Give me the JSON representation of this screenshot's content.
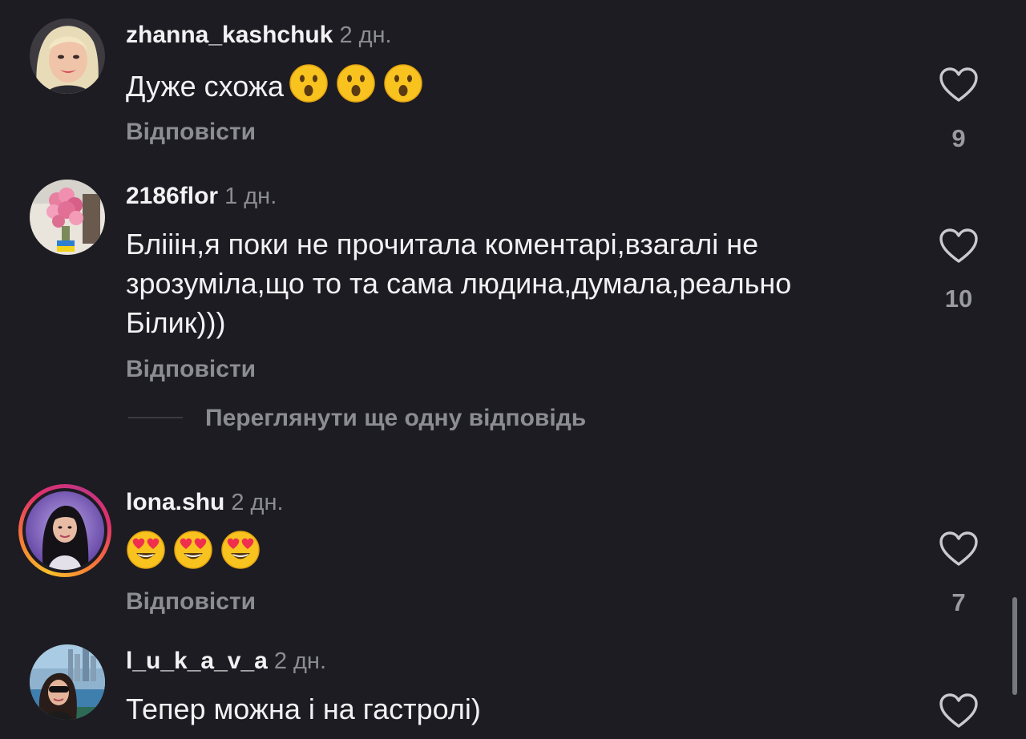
{
  "colors": {
    "background": "#1c1c22",
    "primary_text": "#f2f2f4",
    "secondary_text": "#8c8c93",
    "story_ring": [
      "#f9c02a",
      "#e1306c",
      "#c13584"
    ]
  },
  "comments": [
    {
      "username": "zhanna_kashchuk",
      "time": "2 дн.",
      "text": "Дуже схожа",
      "emoji": [
        "hushed-face-emoji",
        "hushed-face-emoji",
        "hushed-face-emoji"
      ],
      "reply_label": "Відповісти",
      "likes": "9",
      "icon": "heart-icon"
    },
    {
      "username": "2186flor",
      "time": "1 дн.",
      "text": "Бліiін,я поки не прочитала коментарі,взагалі не зрозуміла,що то та сама людина,думала,реально Білик)))",
      "reply_label": "Відповісти",
      "view_replies_label": "Переглянути ще одну відповідь",
      "likes": "10",
      "icon": "heart-icon"
    },
    {
      "username": "lona.shu",
      "time": "2 дн.",
      "text": "",
      "emoji": [
        "heart-eyes-emoji",
        "heart-eyes-emoji",
        "heart-eyes-emoji"
      ],
      "reply_label": "Відповісти",
      "likes": "7",
      "icon": "heart-icon"
    },
    {
      "username": "l_u_k_a_v_a",
      "time": "2 дн.",
      "text": "Тепер можна і на гастролі)",
      "icon": "heart-icon"
    }
  ]
}
